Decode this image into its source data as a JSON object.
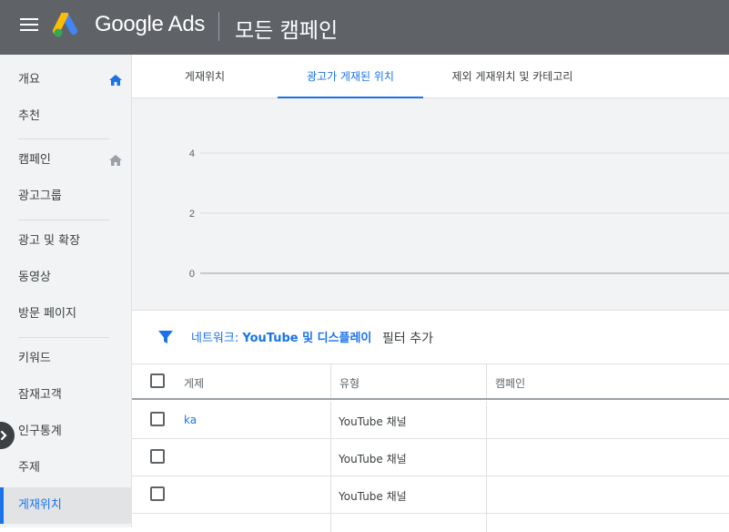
{
  "header": {
    "brand": "Google Ads",
    "page_title": "모든 캠페인"
  },
  "sidebar": {
    "items": [
      {
        "label": "개요",
        "icon": "home-icon"
      },
      {
        "label": "추천"
      },
      {
        "label": "캠페인",
        "icon": "home-icon"
      },
      {
        "label": "광고그룹"
      },
      {
        "label": "광고 및 확장"
      },
      {
        "label": "동영상"
      },
      {
        "label": "방문 페이지"
      },
      {
        "label": "키워드"
      },
      {
        "label": "잠재고객"
      },
      {
        "label": "인구통계"
      },
      {
        "label": "주제"
      },
      {
        "label": "게재위치",
        "active": true
      }
    ]
  },
  "tabs": [
    {
      "label": "게재위치"
    },
    {
      "label": "광고가 게재된 위치",
      "active": true
    },
    {
      "label": "제외 게재위치 및 카테고리"
    }
  ],
  "chart_data": {
    "type": "line",
    "title": "",
    "xlabel": "",
    "ylabel": "",
    "ylim": [
      0,
      4
    ],
    "yticks": [
      "4",
      "2",
      "0"
    ],
    "series": []
  },
  "filter": {
    "prefix": "네트워크: ",
    "value": "YouTube 및 디스플레이",
    "add_label": "필터 추가"
  },
  "table": {
    "columns": [
      "게제",
      "유형",
      "캠페인"
    ],
    "rows": [
      {
        "placement": "ka",
        "type": "YouTube 채널"
      },
      {
        "placement": "",
        "type": "YouTube 채널"
      },
      {
        "placement": "",
        "type": "YouTube 채널"
      }
    ]
  },
  "colors": {
    "topbar": "#5f6368",
    "accent": "#1a73e8",
    "sidebar_bg": "#f1f3f4",
    "chart_bg": "#f1f3f4"
  }
}
